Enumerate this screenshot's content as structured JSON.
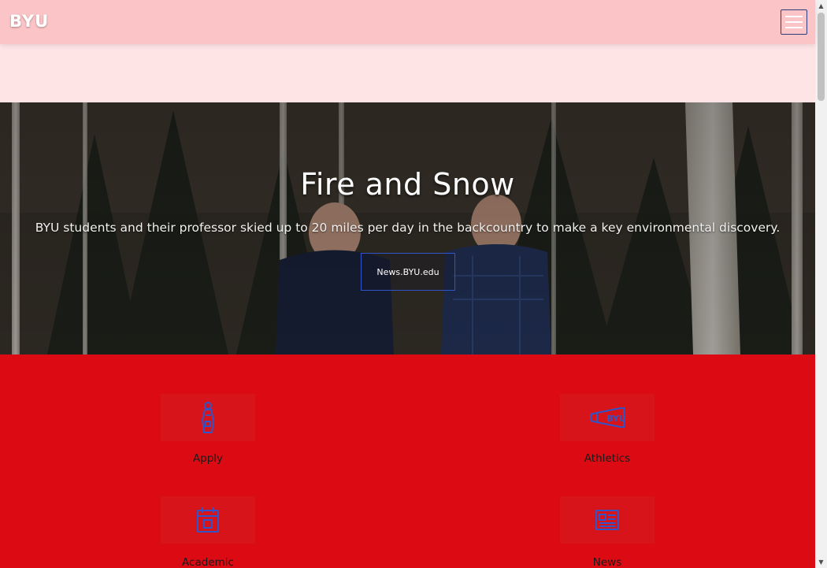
{
  "header": {
    "logo_text": "BYU",
    "menu_icon": "hamburger-menu-icon"
  },
  "hero": {
    "title": "Fire and Snow",
    "subtitle": "BYU students and their professor skied up to 20 miles per day in the backcountry to make a key environmental discovery.",
    "button_label": "News.BYU.edu"
  },
  "quick_links": [
    {
      "label": "Apply",
      "icon": "graduate-figure-icon"
    },
    {
      "label": "Athletics",
      "icon": "byu-megaphone-icon"
    },
    {
      "label": "Academic",
      "icon": "calendar-icon"
    },
    {
      "label": "News",
      "icon": "newspaper-icon"
    }
  ],
  "colors": {
    "header_bg": "#fbc4c6",
    "page_bg": "#ffe4e6",
    "red_section": "#dc0a12",
    "icon_blue": "#2f55c8"
  }
}
